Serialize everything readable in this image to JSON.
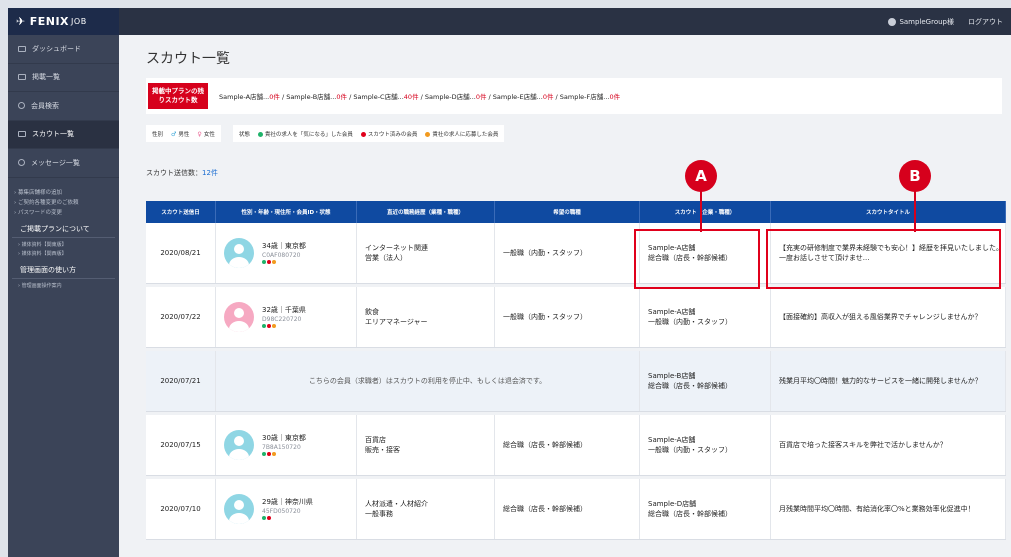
{
  "brand": {
    "name": "FENIX",
    "suffix": "JOB"
  },
  "topbar": {
    "user": "SampleGroup様",
    "logout": "ログアウト"
  },
  "sidebar": {
    "items": [
      {
        "label": "ダッシュボード"
      },
      {
        "label": "掲載一覧"
      },
      {
        "label": "会員検索"
      },
      {
        "label": "スカウト一覧"
      },
      {
        "label": "メッセージ一覧"
      }
    ],
    "sub_links": [
      "募集店舗様の追加",
      "ご契約各種変更のご依頼",
      "パスワードの変更"
    ],
    "plan_heading": "ご掲載プランについて",
    "plan_links": [
      "媒体資料【関東版】",
      "媒体資料【関西版】"
    ],
    "guide_heading": "管理画面の使い方",
    "guide_links": [
      "管理画面操作案内"
    ]
  },
  "page_title": "スカウト一覧",
  "plan": {
    "label": "掲載中プランの残りスカウト数",
    "stores": [
      {
        "name": "Sample-A店舗...",
        "count": "0件"
      },
      {
        "name": "Sample-B店舗...",
        "count": "0件"
      },
      {
        "name": "Sample-C店舗...",
        "count": "40件"
      },
      {
        "name": "Sample-D店舗...",
        "count": "0件"
      },
      {
        "name": "Sample-E店舗...",
        "count": "0件"
      },
      {
        "name": "Sample-F店舗...",
        "count": "0件"
      }
    ]
  },
  "legend": {
    "gender_label": "性別",
    "male": "男性",
    "female": "女性",
    "status_label": "状態",
    "statuses": [
      {
        "label": "貴社の求人を「気になる」した会員",
        "color": "#1fb36a"
      },
      {
        "label": "スカウト済みの会員",
        "color": "#e0001b"
      },
      {
        "label": "貴社の求人に応募した会員",
        "color": "#f29a1f"
      }
    ]
  },
  "scout_count": {
    "label": "スカウト送信数：",
    "value": "12件"
  },
  "table": {
    "headers": [
      "スカウト送信日",
      "性別・年齢・現住所・会員ID・状態",
      "直近の職務経歴（業種・職種）",
      "希望の職種",
      "スカウト（企業・職種）",
      "スカウトタイトル"
    ],
    "rows": [
      {
        "date": "2020/08/21",
        "gender": "m",
        "age": "34歳｜東京都",
        "id": "C0AF080720",
        "history1": "インターネット関連",
        "history2": "営業（法人）",
        "desired": "一般職（内勤・スタッフ）",
        "scout1": "Sample-A店舗",
        "scout2": "総合職（店長・幹部候補）",
        "title": "【充実の研修制度で業界未経験でも安心！】経歴を拝見いたしました。一度お話しさせて頂けませ..."
      },
      {
        "date": "2020/07/22",
        "gender": "f",
        "age": "32歳｜千葉県",
        "id": "D98C220720",
        "history1": "飲食",
        "history2": "エリアマネージャー",
        "desired": "一般職（内勤・スタッフ）",
        "scout1": "Sample-A店舗",
        "scout2": "一般職（内勤・スタッフ）",
        "title": "【面接確約】高収入が狙える風俗業界でチャレンジしませんか？"
      },
      {
        "date": "2020/07/21",
        "withdrawn": "こちらの会員（求職者）はスカウトの利用を停止中、もしくは退会済です。",
        "scout1": "Sample-B店舗",
        "scout2": "総合職（店長・幹部候補）",
        "title": "残業月平均〇時間！魅力的なサービスを一緒に開発しませんか？"
      },
      {
        "date": "2020/07/15",
        "gender": "m",
        "age": "30歳｜東京都",
        "id": "7B8A150720",
        "history1": "百貨店",
        "history2": "販売・接客",
        "desired": "総合職（店長・幹部候補）",
        "scout1": "Sample-A店舗",
        "scout2": "一般職（内勤・スタッフ）",
        "title": "百貨店で培った接客スキルを弊社で活かしませんか？"
      },
      {
        "date": "2020/07/10",
        "gender": "m",
        "age": "29歳｜神奈川県",
        "id": "45FD050720",
        "history1": "人材派遣・人材紹介",
        "history2": "一般事務",
        "desired": "総合職（店長・幹部候補）",
        "scout1": "Sample-D店舗",
        "scout2": "総合職（店長・幹部候補）",
        "title": "月残業時間平均〇時間、有給消化率〇%と業務効率化促進中！"
      }
    ]
  },
  "annotations": {
    "a": "A",
    "b": "B"
  },
  "colors": {
    "accent": "#d6001c",
    "header": "#0f4aa1",
    "sidebar": "#3b4458"
  }
}
